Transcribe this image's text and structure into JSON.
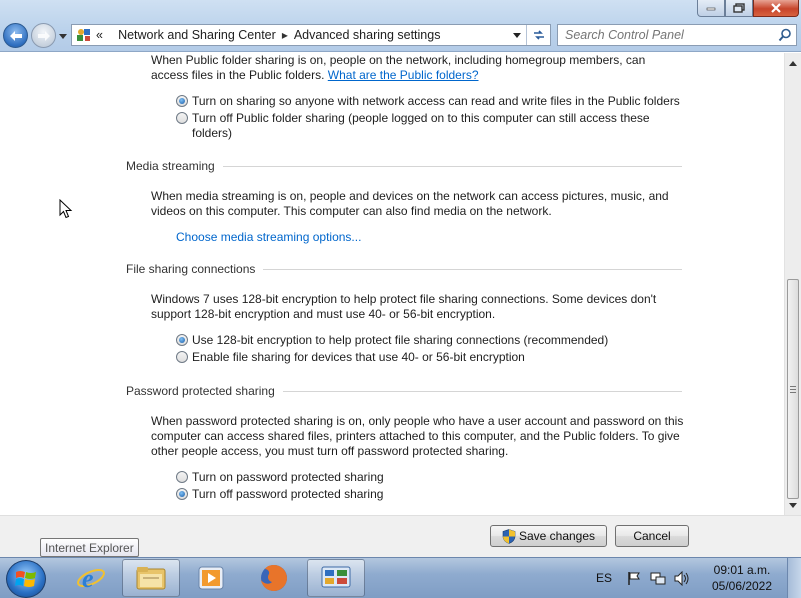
{
  "window": {
    "breadcrumb": [
      "Network and Sharing Center",
      "Advanced sharing settings"
    ],
    "breadcrumb_overflow": "«",
    "search_placeholder": "Search Control Panel"
  },
  "public_folder": {
    "description": "When Public folder sharing is on, people on the network, including homegroup members, can",
    "description_line2": "access files in the Public folders.",
    "help_link": "What are the Public folders?",
    "options": [
      {
        "label": "Turn on sharing so anyone with network access can read and write files in the Public folders",
        "selected": true
      },
      {
        "label": "Turn off Public folder sharing (people logged on to this computer can still access these",
        "label_line2": "folders)",
        "selected": false
      }
    ]
  },
  "media_streaming": {
    "heading": "Media streaming",
    "description": "When media streaming is on, people and devices on the network can access pictures, music, and",
    "description_line2": "videos on this computer. This computer can also find media on the network.",
    "link": "Choose media streaming options..."
  },
  "file_sharing": {
    "heading": "File sharing connections",
    "description": "Windows 7 uses 128-bit encryption to help protect file sharing connections. Some devices don't",
    "description_line2": "support 128-bit encryption and must use 40- or 56-bit encryption.",
    "options": [
      {
        "label": "Use 128-bit encryption to help protect file sharing connections (recommended)",
        "selected": true
      },
      {
        "label": "Enable file sharing for devices that use 40- or 56-bit encryption",
        "selected": false
      }
    ]
  },
  "password_sharing": {
    "heading": "Password protected sharing",
    "description": "When password protected sharing is on, only people who have a user account and password on this",
    "description_line2": "computer can access shared files, printers attached to this computer, and the Public folders. To give",
    "description_line3": "other people access, you must turn off password protected sharing.",
    "options": [
      {
        "label": "Turn on password protected sharing",
        "selected": false
      },
      {
        "label": "Turn off password protected sharing",
        "selected": true
      }
    ]
  },
  "footer": {
    "save_label": "Save changes",
    "cancel_label": "Cancel"
  },
  "tooltip": "Internet Explorer",
  "taskbar": {
    "language": "ES",
    "time": "09:01 a.m.",
    "date": "05/06/2022",
    "apps": [
      "internet-explorer",
      "windows-explorer",
      "media-player",
      "firefox",
      "control-panel"
    ]
  },
  "colors": {
    "link": "#0066cc",
    "footer_bg": "#f0f0f0",
    "taskbar": "#8fabcf"
  }
}
